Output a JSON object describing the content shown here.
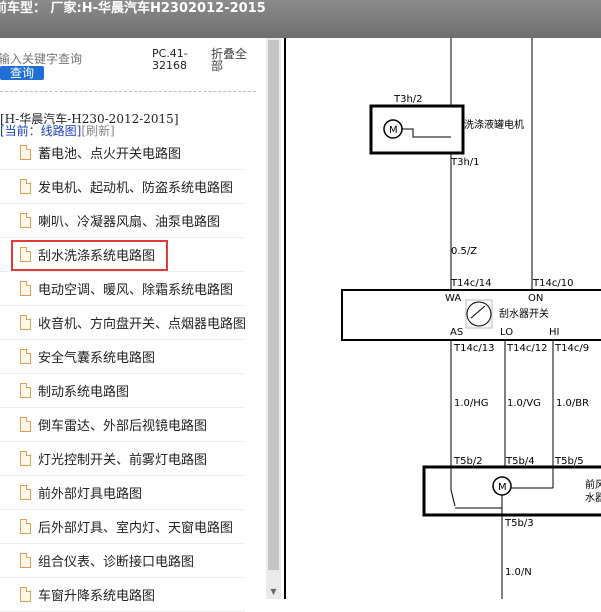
{
  "title": "前车型：  厂家:H-华晨汽车H2302012-2015",
  "search": {
    "placeholder": "输入关键字查询",
    "button": "查询"
  },
  "code": "PC.41-32168",
  "fold": "折叠全部",
  "tree_root": "[H-华晨汽车-H230-2012-2015]",
  "breadcrumb": {
    "current": "[当前：线路图]",
    "refresh": "[刷新]"
  },
  "items": [
    "蓄电池、点火开关电路图",
    "发电机、起动机、防盗系统电路图",
    "喇叭、冷凝器风扇、油泵电路图",
    "刮水洗涤系统电路图",
    "电动空调、暖风、除霜系统电路图",
    "收音机、方向盘开关、点烟器电路图",
    "安全气囊系统电路图",
    "制动系统电路图",
    "倒车雷达、外部后视镜电路图",
    "灯光控制开关、前雾灯电路图",
    "前外部灯具电路图",
    "后外部灯具、室内灯、天窗电路图",
    "组合仪表、诊断接口电路图",
    "车窗升降系统电路图"
  ],
  "selected_index": 3,
  "diagram": {
    "washer_motor": "洗涤液罐电机",
    "t3h2": "T3h/2",
    "t3h1": "T3h/1",
    "wire_05z": "0.5/Z",
    "t14c14": "T14c/14",
    "t14c10": "T14c/10",
    "wa": "WA",
    "on": "ON",
    "switch": "刮水器开关",
    "as": "AS",
    "lo": "LO",
    "hi": "HI",
    "t14c13": "T14c/13",
    "t14c12": "T14c/12",
    "t14c9": "T14c/9",
    "w_hg": "1.0/HG",
    "w_vg": "1.0/VG",
    "w_br": "1.0/BR",
    "t5b2": "T5b/2",
    "t5b4": "T5b/4",
    "t5b5": "T5b/5",
    "t5b3": "T5b/3",
    "w_n": "1.0/N",
    "front1": "前风",
    "front2": "水器",
    "m": "M"
  }
}
